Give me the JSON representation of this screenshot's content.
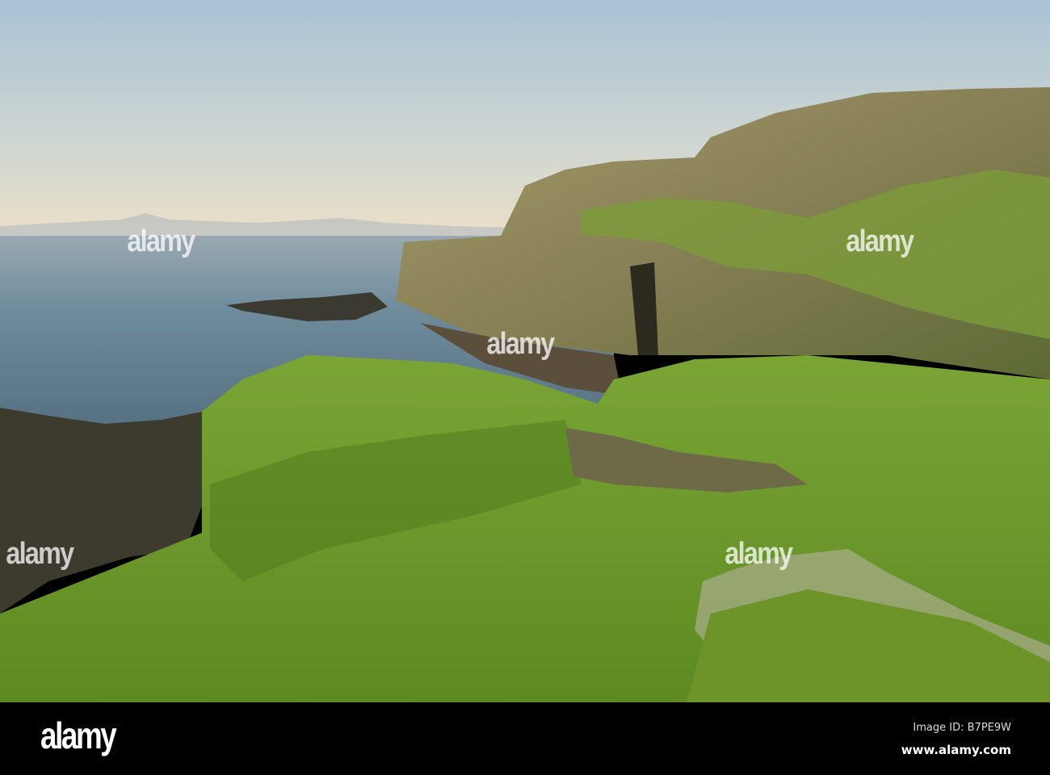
{
  "watermark": {
    "text": "alamy"
  },
  "footer": {
    "logo": "alamy",
    "image_id": "Image ID: B7PE9W",
    "url": "www.alamy.com"
  },
  "colors": {
    "sky_top": "#a8c2d4",
    "sky_horizon": "#ece0c8",
    "sea": "#5f7f92",
    "grass": "#6f9a2c",
    "cliff": "#8c8758"
  }
}
